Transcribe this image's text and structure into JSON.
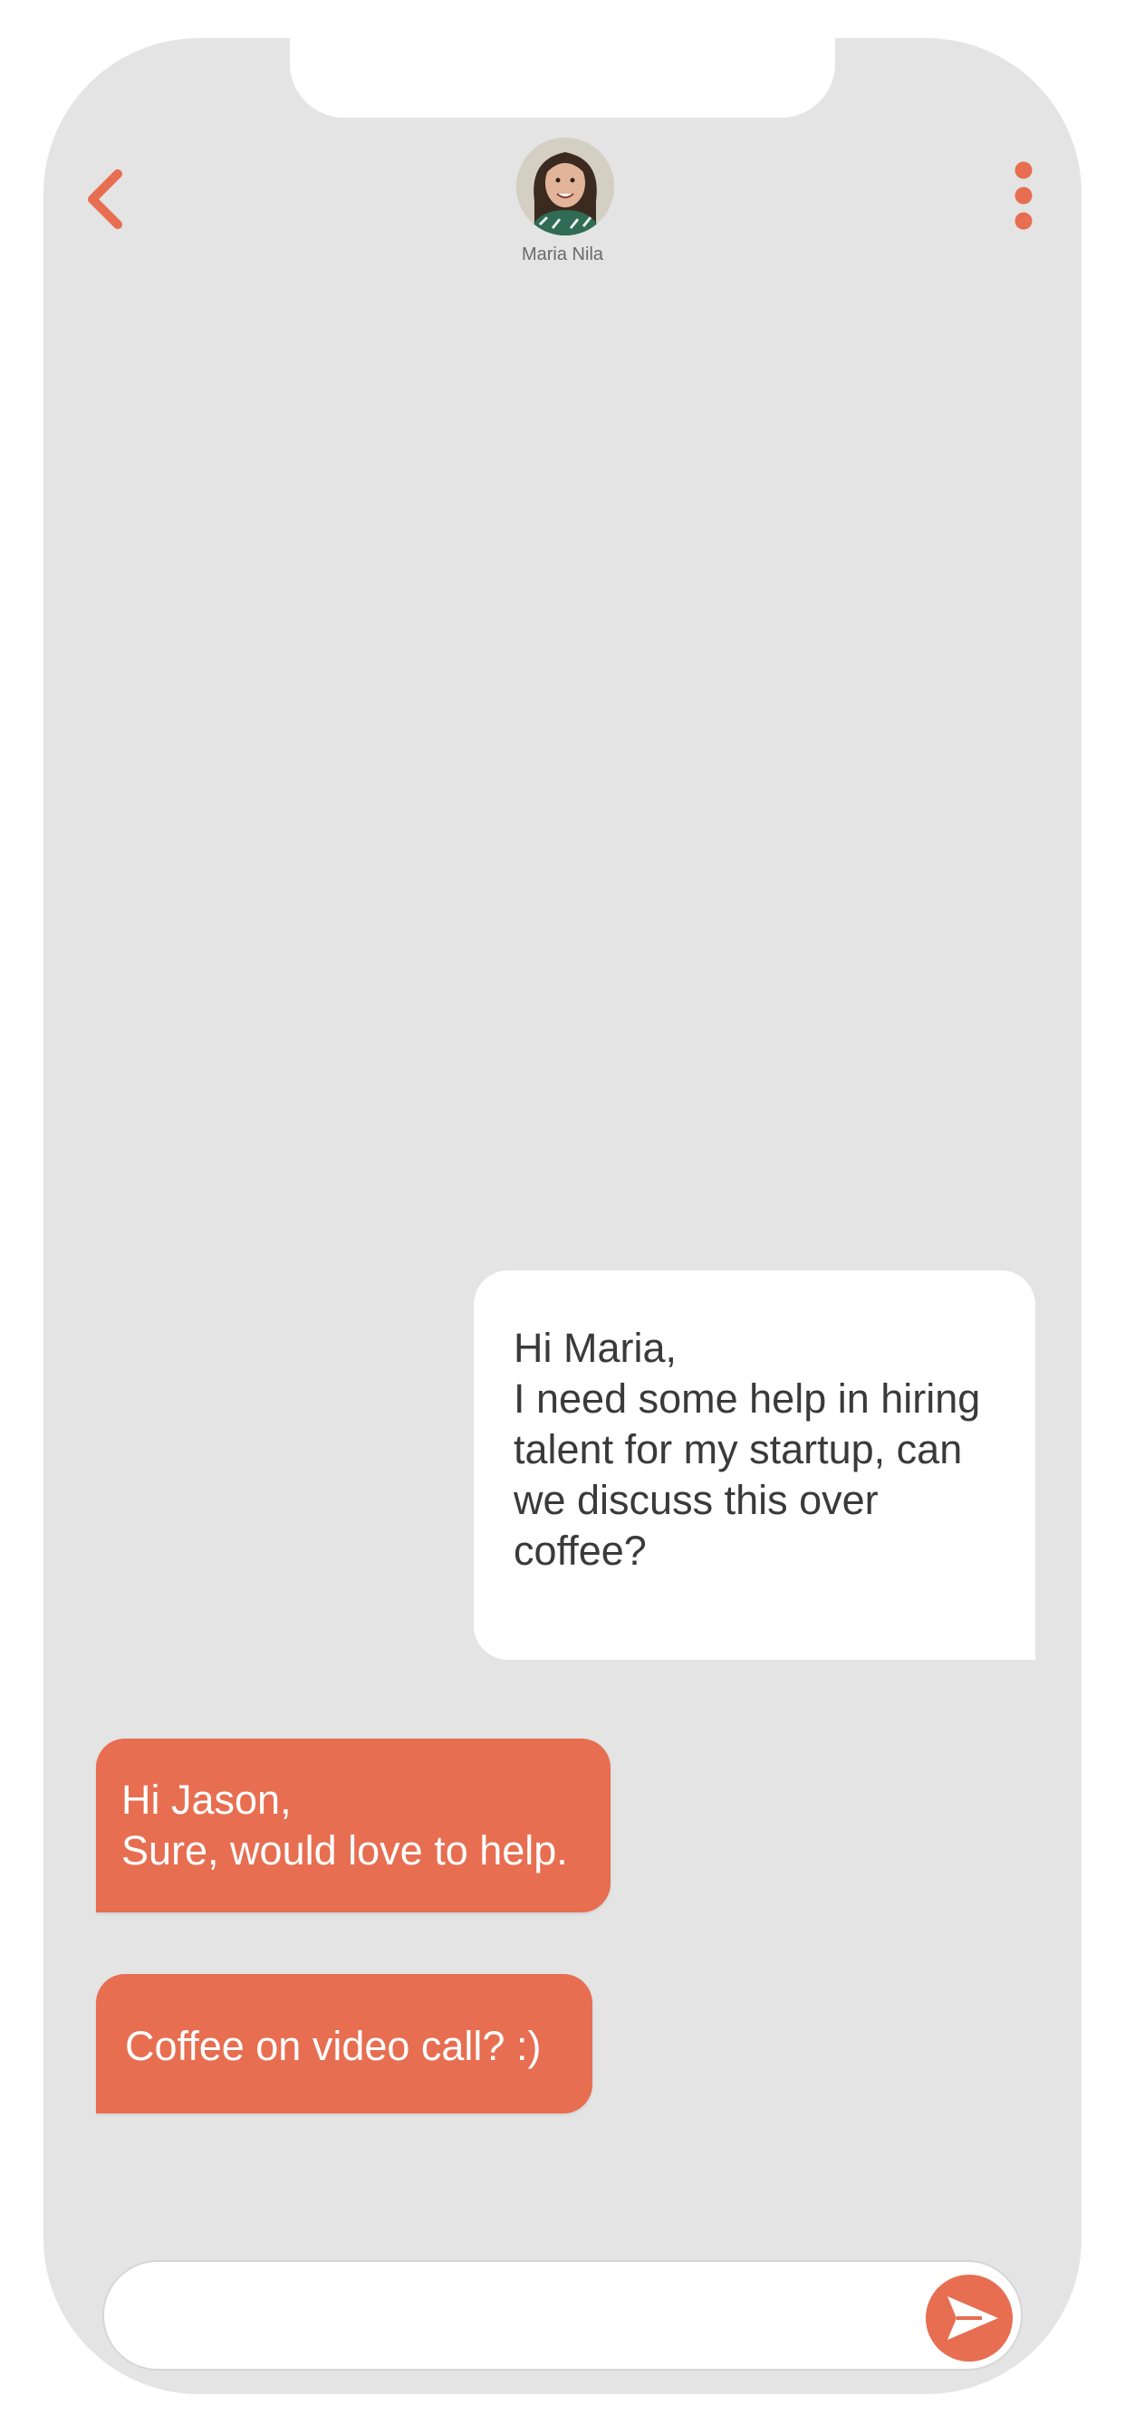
{
  "theme": {
    "accent": "#e76e51",
    "background": "#e4e4e4",
    "bubble_outgoing": "#ffffff",
    "bubble_incoming": "#e76e51"
  },
  "header": {
    "back_icon": "chevron-left-icon",
    "menu_icon": "vertical-dots-icon",
    "contact": {
      "name": "Maria Nila",
      "avatar": "profile-photo"
    }
  },
  "messages": [
    {
      "direction": "outgoing",
      "text": "Hi Maria,\nI need some help in hiring talent for my startup, can we discuss this over coffee?"
    },
    {
      "direction": "incoming",
      "text": "Hi Jason,\nSure, would love to help."
    },
    {
      "direction": "incoming",
      "text": "Coffee on video call? :)"
    }
  ],
  "composer": {
    "value": "",
    "placeholder": "",
    "send_icon": "send-icon"
  }
}
